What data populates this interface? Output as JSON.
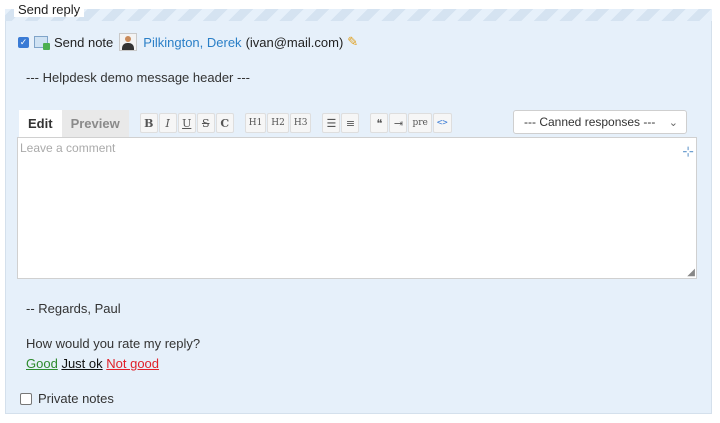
{
  "panel": {
    "legend": "Send reply",
    "send_note": {
      "checked": true,
      "label": "Send note",
      "recipient_name": "Pilkington, Derek",
      "recipient_email": "(ivan@mail.com)"
    },
    "message_header": "--- Helpdesk demo message header ---"
  },
  "editor": {
    "tabs": [
      "Edit",
      "Preview"
    ],
    "active_tab": "Edit",
    "toolbar": {
      "bold": "B",
      "italic": "I",
      "underline": "U",
      "strike": "S",
      "code": "C",
      "h1": "H1",
      "h2": "H2",
      "h3": "H3",
      "pre": "pre",
      "html": "<>"
    },
    "canned_select": "--- Canned responses ---",
    "placeholder": "Leave a comment"
  },
  "footer": {
    "regards": "-- Regards, Paul",
    "rating_question": "How would you rate my reply?",
    "ratings": [
      "Good",
      "Just ok",
      "Not good"
    ]
  },
  "private_notes": {
    "checked": false,
    "label": "Private notes"
  },
  "colors": {
    "panel_bg": "#e6f0fa",
    "link_blue": "#2a7fc7",
    "good": "#2e8b2e",
    "not_good": "#e0202a"
  }
}
